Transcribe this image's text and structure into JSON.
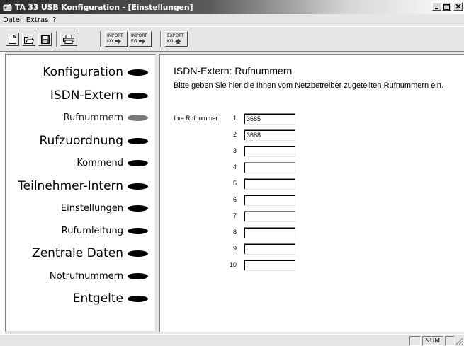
{
  "window": {
    "title": "TA 33 USB Konfiguration - [Einstellungen]"
  },
  "menu": [
    "Datei",
    "Extras",
    "?"
  ],
  "toolbar": {
    "import_ko": {
      "line1": "IMPORT",
      "line2": "KO"
    },
    "import_eg": {
      "line1": "IMPORT",
      "line2": "EG"
    },
    "export_ko": {
      "line1": "EXPORT",
      "line2": "KO"
    }
  },
  "nav": [
    {
      "label": "Konfiguration",
      "level": 1,
      "active": false
    },
    {
      "label": "ISDN-Extern",
      "level": 1,
      "active": false
    },
    {
      "label": "Rufnummern",
      "level": 2,
      "active": true
    },
    {
      "label": "Rufzuordnung",
      "level": 1,
      "active": false
    },
    {
      "label": "Kommend",
      "level": 2,
      "active": false
    },
    {
      "label": "Teilnehmer-Intern",
      "level": 1,
      "active": false
    },
    {
      "label": "Einstellungen",
      "level": 2,
      "active": false
    },
    {
      "label": "Rufumleitung",
      "level": 2,
      "active": false
    },
    {
      "label": "Zentrale Daten",
      "level": 1,
      "active": false
    },
    {
      "label": "Notrufnummern",
      "level": 2,
      "active": false
    },
    {
      "label": "Entgelte",
      "level": 1,
      "active": false
    }
  ],
  "main": {
    "heading": "ISDN-Extern: Rufnummern",
    "subtitle": "Bitte geben Sie hier die Ihnen vom Netzbetreiber zugeteilten Rufnummern ein.",
    "numbers_label": "Ihre Rufnummer",
    "numbers": [
      {
        "index": "1",
        "value": "3685"
      },
      {
        "index": "2",
        "value": "3688"
      },
      {
        "index": "3",
        "value": ""
      },
      {
        "index": "4",
        "value": ""
      },
      {
        "index": "5",
        "value": ""
      },
      {
        "index": "6",
        "value": ""
      },
      {
        "index": "7",
        "value": ""
      },
      {
        "index": "8",
        "value": ""
      },
      {
        "index": "9",
        "value": ""
      },
      {
        "index": "10",
        "value": ""
      }
    ]
  },
  "statusbar": {
    "num": "NUM"
  }
}
